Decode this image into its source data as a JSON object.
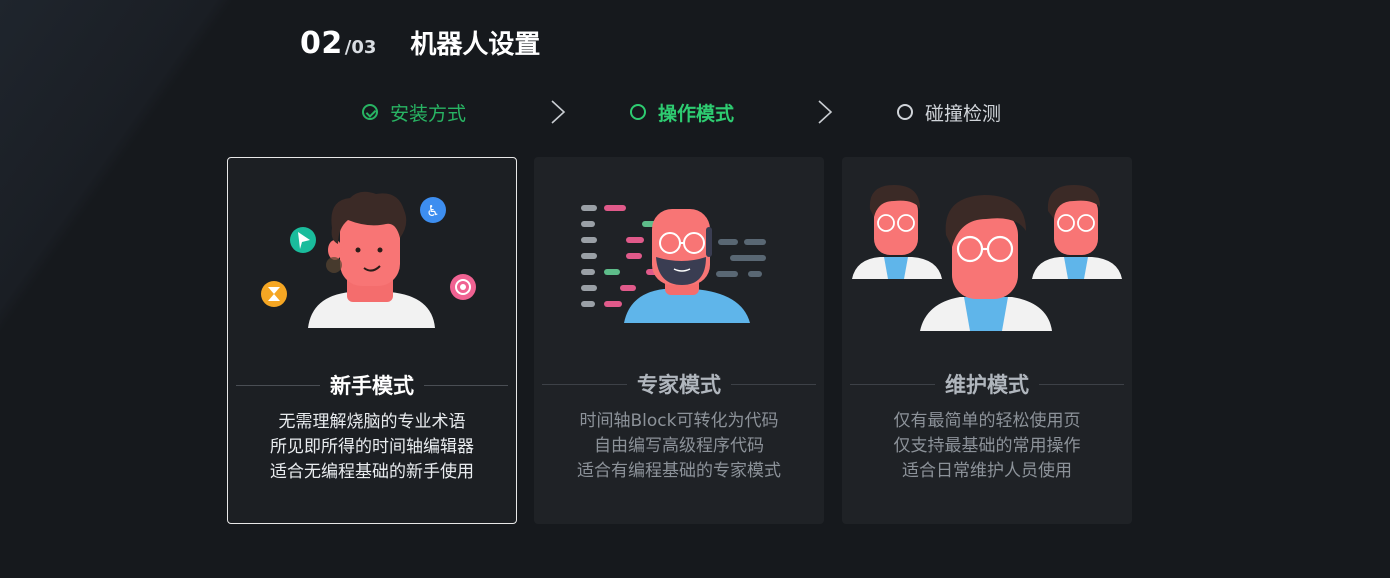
{
  "header": {
    "step_current": "02",
    "step_total": "/03",
    "title": "机器人设置"
  },
  "stepper": {
    "steps": [
      {
        "label": "安装方式",
        "state": "done"
      },
      {
        "label": "操作模式",
        "state": "active"
      },
      {
        "label": "碰撞检测",
        "state": "todo"
      }
    ]
  },
  "modes": [
    {
      "title": "新手模式",
      "selected": true,
      "lines": [
        "无需理解烧脑的专业术语",
        "所见即所得的时间轴编辑器",
        "适合无编程基础的新手使用"
      ]
    },
    {
      "title": "专家模式",
      "selected": false,
      "lines": [
        "时间轴Block可转化为代码",
        "自由编写高级程序代码",
        "适合有编程基础的专家模式"
      ]
    },
    {
      "title": "维护模式",
      "selected": false,
      "lines": [
        "仅有最简单的轻松使用页",
        "仅支持最基础的常用操作",
        "适合日常维护人员使用"
      ]
    }
  ],
  "colors": {
    "success": "#28b463",
    "active": "#2ecc71",
    "card_bg": "#1f2226",
    "page_bg": "#16191d"
  }
}
